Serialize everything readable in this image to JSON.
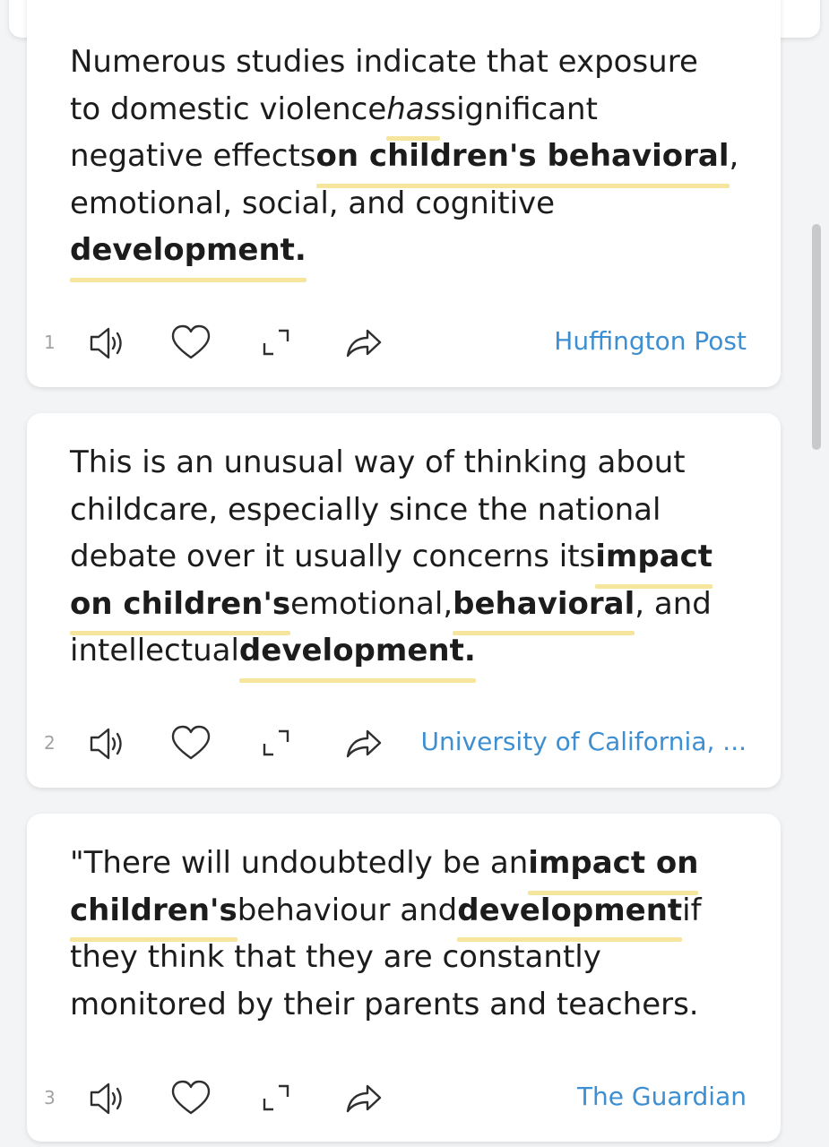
{
  "icons": {
    "search": "search-icon",
    "listen": "speaker-icon",
    "favorite": "heart-icon",
    "expand": "expand-icon",
    "share": "share-icon"
  },
  "colors": {
    "highlight_underline": "#f6e59d",
    "source_link": "#3d8fd1",
    "card_background": "#ffffff",
    "page_background": "#f3f4f6"
  },
  "results": [
    {
      "number": "1",
      "source": "Huffington Post",
      "lines": [
        [
          {
            "t": "Numerous studies indicate that exposure",
            "b": false,
            "i": false,
            "u": false
          }
        ],
        [
          {
            "t": "to domestic violence ",
            "b": false,
            "i": false,
            "u": false
          },
          {
            "t": "has",
            "b": false,
            "i": true,
            "u": true
          },
          {
            "t": " significant",
            "b": false,
            "i": false,
            "u": false
          }
        ],
        [
          {
            "t": "negative effects ",
            "b": false,
            "i": false,
            "u": false
          },
          {
            "t": "on children's behavioral",
            "b": true,
            "i": false,
            "u": true
          },
          {
            "t": ",",
            "b": false,
            "i": false,
            "u": false
          }
        ],
        [
          {
            "t": "emotional, social, and cognitive",
            "b": false,
            "i": false,
            "u": false
          }
        ],
        [
          {
            "t": "development.",
            "b": true,
            "i": false,
            "u": true
          }
        ]
      ]
    },
    {
      "number": "2",
      "source": "University of California, ...",
      "lines": [
        [
          {
            "t": "This is an unusual way of thinking about",
            "b": false,
            "i": false,
            "u": false
          }
        ],
        [
          {
            "t": "childcare, especially since the national",
            "b": false,
            "i": false,
            "u": false
          }
        ],
        [
          {
            "t": "debate over it usually concerns its ",
            "b": false,
            "i": false,
            "u": false
          },
          {
            "t": "impact",
            "b": true,
            "i": false,
            "u": true
          }
        ],
        [
          {
            "t": "on children's",
            "b": true,
            "i": false,
            "u": true
          },
          {
            "t": " emotional, ",
            "b": false,
            "i": false,
            "u": false
          },
          {
            "t": "behavioral",
            "b": true,
            "i": false,
            "u": true
          },
          {
            "t": ", and",
            "b": false,
            "i": false,
            "u": false
          }
        ],
        [
          {
            "t": "intellectual ",
            "b": false,
            "i": false,
            "u": false
          },
          {
            "t": "development.",
            "b": true,
            "i": false,
            "u": true
          }
        ]
      ]
    },
    {
      "number": "3",
      "source": "The Guardian",
      "lines": [
        [
          {
            "t": "\"There will undoubtedly be an ",
            "b": false,
            "i": false,
            "u": false
          },
          {
            "t": "impact on",
            "b": true,
            "i": false,
            "u": true
          }
        ],
        [
          {
            "t": "children's",
            "b": true,
            "i": false,
            "u": true
          },
          {
            "t": " behaviour and ",
            "b": false,
            "i": false,
            "u": false
          },
          {
            "t": "development",
            "b": true,
            "i": false,
            "u": true
          },
          {
            "t": " if",
            "b": false,
            "i": false,
            "u": false
          }
        ],
        [
          {
            "t": "they think that they are constantly",
            "b": false,
            "i": false,
            "u": false
          }
        ],
        [
          {
            "t": "monitored by their parents and teachers.",
            "b": false,
            "i": false,
            "u": false
          }
        ]
      ]
    }
  ]
}
